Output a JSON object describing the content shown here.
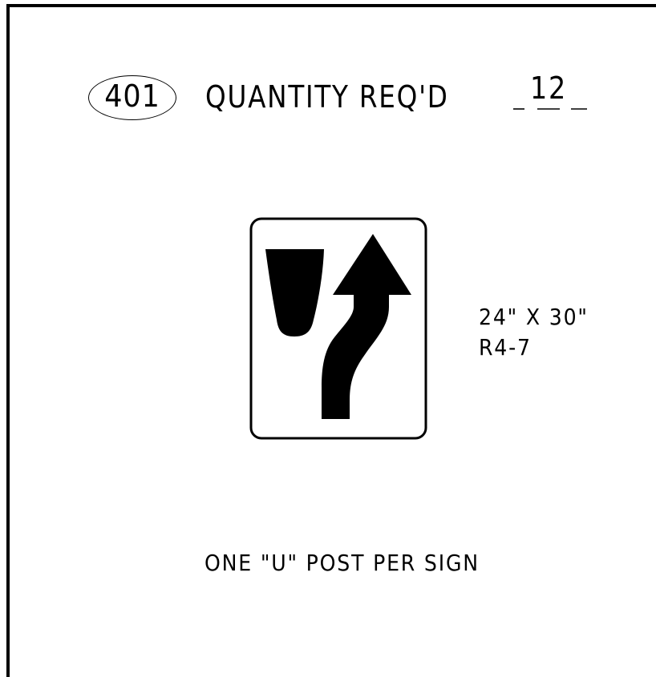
{
  "sheet": {
    "sign_number": "401",
    "quantity_label": "QUANTITY REQ'D",
    "quantity_value": "12"
  },
  "sign": {
    "size": "24\" X 30\"",
    "code": "R4-7",
    "symbol": "keep-right-arrow-with-median",
    "colors": {
      "background": "#ffffff",
      "legend": "#000000",
      "border": "#000000"
    }
  },
  "note": "ONE \"U\" POST PER SIGN"
}
